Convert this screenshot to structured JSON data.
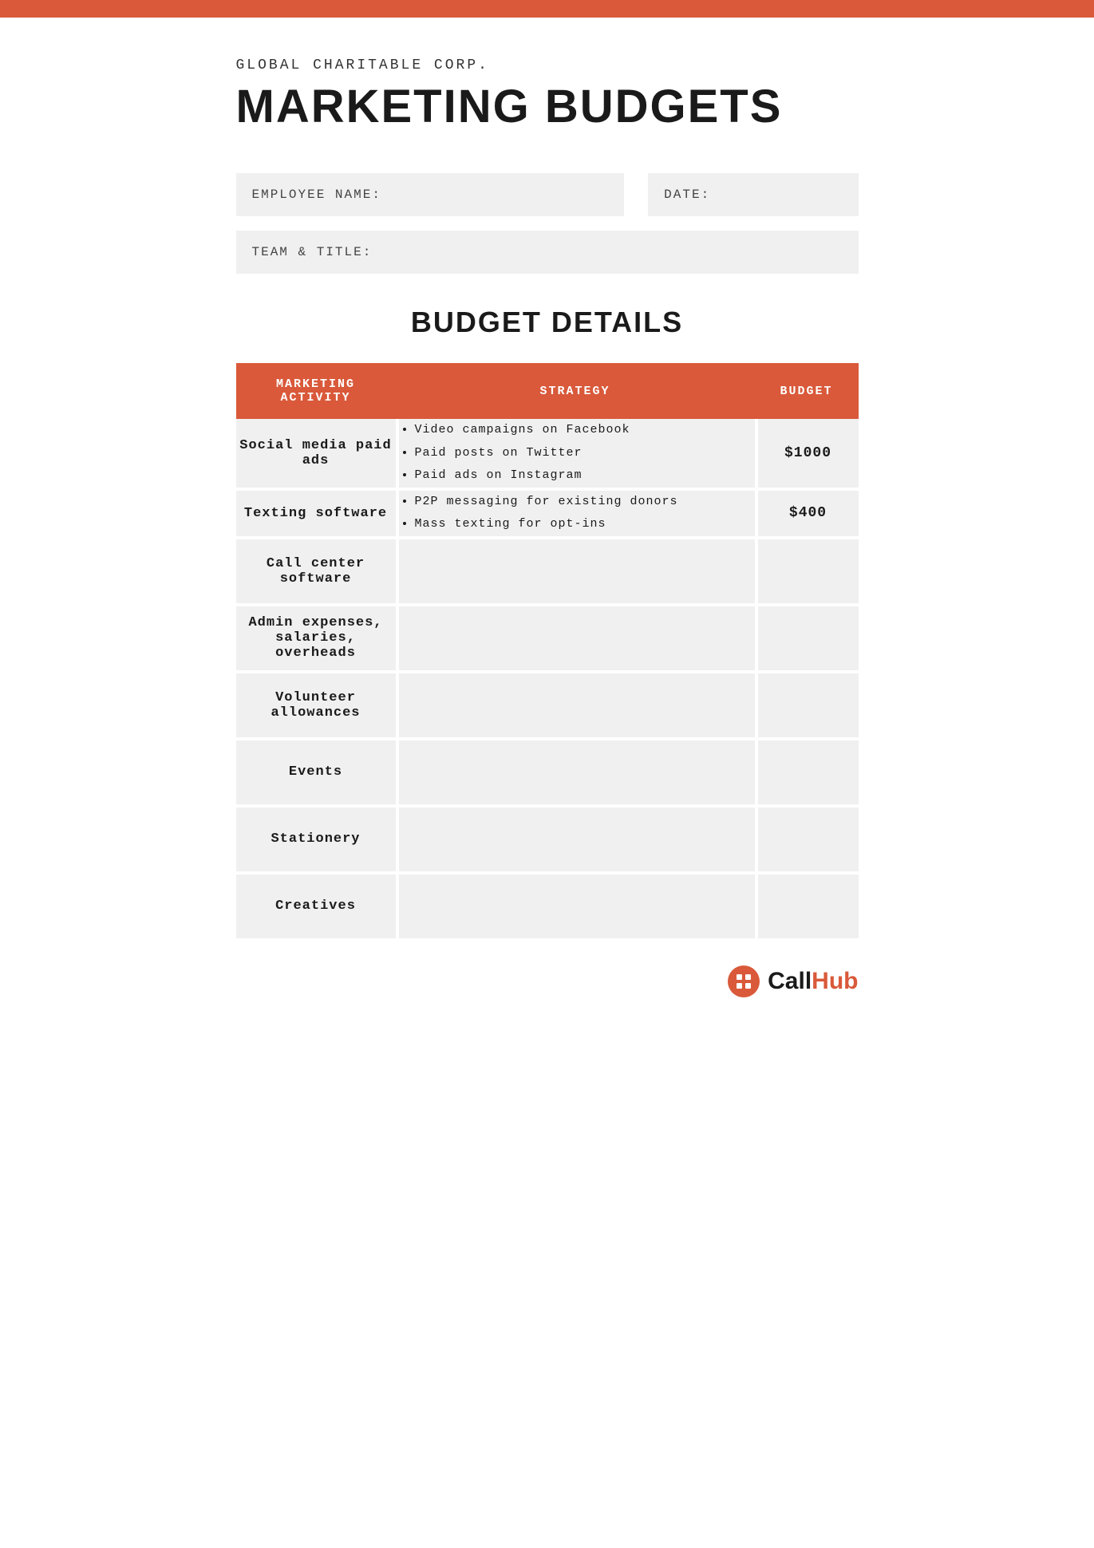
{
  "top_bar": {
    "color": "#d9593a"
  },
  "header": {
    "org_name": "GLOBAL CHARITABLE CORP.",
    "title": "MARKETING BUDGETS"
  },
  "form": {
    "employee_name_label": "EMPLOYEE NAME:",
    "date_label": "DATE:",
    "team_title_label": "TEAM & TITLE:"
  },
  "budget_section": {
    "title": "BUDGET DETAILS",
    "table_headers": {
      "activity": "MARKETING ACTIVITY",
      "strategy": "STRATEGY",
      "budget": "BUDGET"
    },
    "rows": [
      {
        "activity": "Social media paid ads",
        "strategy_items": [
          "Video campaigns on Facebook",
          "Paid posts on Twitter",
          "Paid ads on Instagram"
        ],
        "budget": "$1000"
      },
      {
        "activity": "Texting software",
        "strategy_items": [
          "P2P messaging for existing donors",
          "Mass texting for opt-ins"
        ],
        "budget": "$400"
      },
      {
        "activity": "Call center software",
        "strategy_items": [],
        "budget": ""
      },
      {
        "activity": "Admin expenses, salaries, overheads",
        "strategy_items": [],
        "budget": ""
      },
      {
        "activity": "Volunteer allowances",
        "strategy_items": [],
        "budget": ""
      },
      {
        "activity": "Events",
        "strategy_items": [],
        "budget": ""
      },
      {
        "activity": "Stationery",
        "strategy_items": [],
        "budget": ""
      },
      {
        "activity": "Creatives",
        "strategy_items": [],
        "budget": ""
      }
    ]
  },
  "logo": {
    "icon_symbol": "⊞",
    "text_black": "Call",
    "text_orange": "Hub"
  }
}
